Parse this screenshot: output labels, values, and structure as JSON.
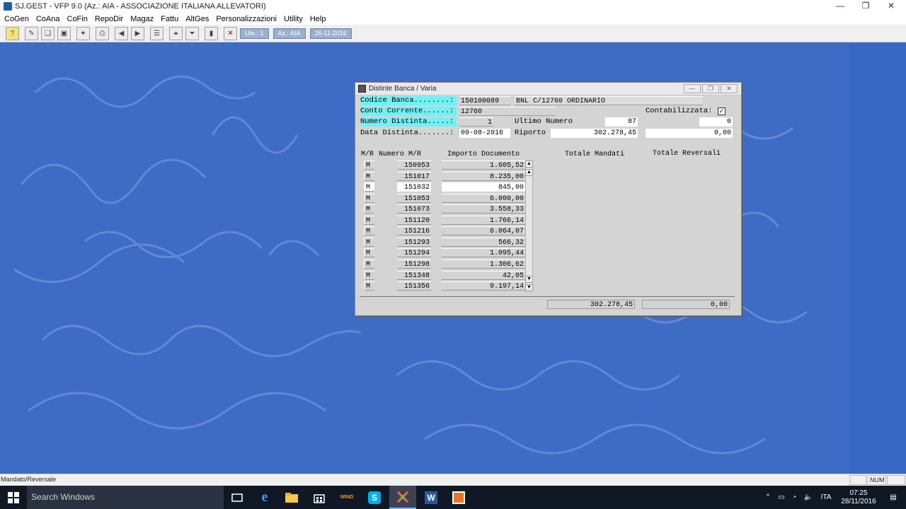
{
  "window": {
    "title": "SJ.GEST - VFP 9.0 (Az.: AIA - ASSOCIAZIONE ITALIANA ALLEVATORI)",
    "controls": [
      "—",
      "❐",
      "✕"
    ]
  },
  "menu": [
    "CoGen",
    "CoAna",
    "CoFin",
    "RepoDir",
    "Magaz",
    "Fattu",
    "AltGes",
    "Personalizzazioni",
    "Utility",
    "Help"
  ],
  "toolbar": {
    "badges": [
      "Ute.: 1",
      "Az.: AIA",
      "26-11-2016"
    ]
  },
  "dialog": {
    "title": "Distinte Banca / Varia",
    "fields": {
      "codice_banca_label": "Codice Banca........:",
      "codice_banca_value": "150100089",
      "codice_banca_desc": "BNL C/12760 ORDINARIO",
      "conto_corrente_label": "Conto Corrente......:",
      "conto_corrente_value": "12760",
      "contabilizzata_label": "Contabilizzata:",
      "contabilizzata_checked": "✓",
      "numero_distinta_label": "Numero Distinta.....:",
      "numero_distinta_value": "1",
      "ultimo_numero_label": "Ultimo Numero",
      "ultimo_numero_value": "87",
      "ultimo_numero_value2": "0",
      "data_distinta_label": "Data Distinta.......:",
      "data_distinta_value": "09-08-2016",
      "riporto_label": "Riporto",
      "riporto_value": "302.278,45",
      "riporto_value2": "0,00"
    },
    "columns": {
      "mr": "M/R",
      "numero": "Numero M/R",
      "importo": "Importo Documento",
      "tot_mandati": "Totale Mandati",
      "tot_reversali": "Totale Reversali"
    },
    "rows": [
      {
        "mr": "M",
        "numero": "150953",
        "importo": "1.605,52"
      },
      {
        "mr": "M",
        "numero": "151017",
        "importo": "8.235,00"
      },
      {
        "mr": "M",
        "numero": "151032",
        "importo": "845,00"
      },
      {
        "mr": "M",
        "numero": "151053",
        "importo": "6.000,00"
      },
      {
        "mr": "M",
        "numero": "151073",
        "importo": "3.558,33"
      },
      {
        "mr": "M",
        "numero": "151120",
        "importo": "1.766,14"
      },
      {
        "mr": "M",
        "numero": "151216",
        "importo": "6.064,07"
      },
      {
        "mr": "M",
        "numero": "151293",
        "importo": "566,32"
      },
      {
        "mr": "M",
        "numero": "151294",
        "importo": "1.095,44"
      },
      {
        "mr": "M",
        "numero": "151298",
        "importo": "1.306,62"
      },
      {
        "mr": "M",
        "numero": "151348",
        "importo": "42,05"
      },
      {
        "mr": "M",
        "numero": "151356",
        "importo": "9.197,14"
      }
    ],
    "totals": {
      "mandati": "302.278,45",
      "reversali": "0,00"
    }
  },
  "statusbar": {
    "text": "Mandato/Reversale",
    "num": "NUM"
  },
  "taskbar": {
    "search_placeholder": "Search Windows",
    "lang": "ITA",
    "time": "07:25",
    "date": "28/11/2016"
  },
  "colors": {
    "desktop": "#3e6cc4",
    "label_highlight": "#6ff2f6",
    "dialog_bg": "#d4d4d4",
    "taskbar": "#101826"
  }
}
